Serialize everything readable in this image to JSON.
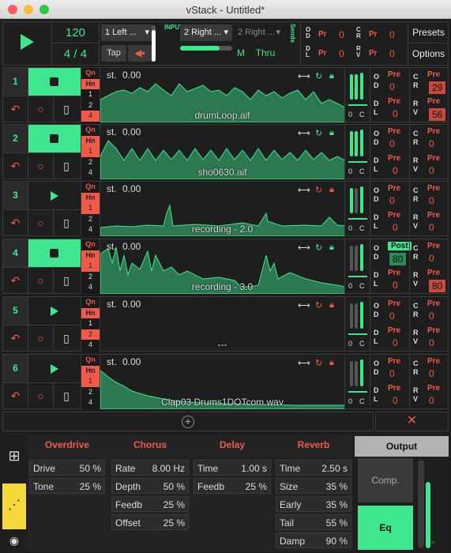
{
  "window": {
    "title": "vStack - Untitled*"
  },
  "colors": {
    "accent": "#3ee68f",
    "red": "#f05a4a",
    "yellow": "#f5d839"
  },
  "transport": {
    "bpm": "120",
    "signature": "4 / 4",
    "tap": "Tap"
  },
  "input": {
    "label": "INPUT",
    "source_left": "1 Left ...",
    "source_right": "2 Right ...",
    "source_right2": "2 Right ...",
    "m": "M",
    "thru": "Thru"
  },
  "sends": {
    "label": "Sends",
    "od_pr": "Pr",
    "od_val": "0",
    "dl_pr": "Pr",
    "dl_val": "0",
    "cr_pr": "Pr",
    "cr_val": "0",
    "rv_pr": "Pr",
    "rv_val": "0",
    "od": "O D",
    "dl": "D L",
    "cr": "C R",
    "rv": "R V"
  },
  "menu": {
    "presets": "Presets",
    "options": "Options"
  },
  "tracks": [
    {
      "num": "1",
      "playing": true,
      "st": "st.",
      "st_val": "0.00",
      "file": "drumLoop.aif",
      "qh": [
        "Qn",
        "Hn",
        "1",
        "2",
        "4"
      ],
      "sel": 3,
      "od": "Pre",
      "od_val": "0",
      "dl": "Pre",
      "dl_val": "0",
      "cr": "Pre",
      "cr_val": "29",
      "rv": "Pre",
      "rv_val": "56",
      "lock": "green"
    },
    {
      "num": "2",
      "playing": true,
      "st": "st.",
      "st_val": "0.00",
      "file": "sho0630.aif",
      "qh": [
        "Qn",
        "Hn",
        "1",
        "2",
        "4"
      ],
      "sel": 1,
      "od": "Pre",
      "od_val": "0",
      "dl": "Pre",
      "dl_val": "0",
      "cr": "Pre",
      "cr_val": "0",
      "rv": "Pre",
      "rv_val": "0",
      "lock": "green"
    },
    {
      "num": "3",
      "playing": false,
      "st": "st.",
      "st_val": "0.00",
      "file": "recording - 2.0",
      "qh": [
        "Qn",
        "Hn",
        "1",
        "2",
        "4"
      ],
      "sel": 1,
      "od": "Pre",
      "od_val": "0",
      "dl": "Pre",
      "dl_val": "0",
      "cr": "Pre",
      "cr_val": "0",
      "rv": "Pre",
      "rv_val": "0",
      "lock": "red"
    },
    {
      "num": "4",
      "playing": true,
      "st": "st.",
      "st_val": "0.00",
      "file": "recording - 3.0",
      "qh": [
        "Qn",
        "Hn",
        "1",
        "2",
        "4"
      ],
      "sel": 1,
      "od": "Post",
      "od_val": "80",
      "dl": "Pre",
      "dl_val": "0",
      "cr": "Pre",
      "cr_val": "0",
      "rv": "Pre",
      "rv_val": "80",
      "lock": "green"
    },
    {
      "num": "5",
      "playing": false,
      "st": "st.",
      "st_val": "0.00",
      "file": "---",
      "qh": [
        "Qn",
        "Hn",
        "1",
        "2",
        "4"
      ],
      "sel": 2,
      "od": "Pre",
      "od_val": "0",
      "dl": "Pre",
      "dl_val": "0",
      "cr": "Pre",
      "cr_val": "0",
      "rv": "Pre",
      "rv_val": "0",
      "lock": "red"
    },
    {
      "num": "6",
      "playing": false,
      "st": "st.",
      "st_val": "0.00",
      "file": "Clap03 Drums1DOTcom.wav",
      "qh": [
        "Qn",
        "Hn",
        "1",
        "2",
        "4"
      ],
      "sel": 1,
      "od": "Pre",
      "od_val": "0",
      "dl": "Pre",
      "dl_val": "0",
      "cr": "Pre",
      "cr_val": "0",
      "rv": "Pre",
      "rv_val": "0",
      "lock": "red"
    }
  ],
  "meter_labels": {
    "o": "0",
    "c": "C"
  },
  "fx": {
    "overdrive": {
      "title": "Overdrive",
      "rows": [
        [
          "Drive",
          "50 %"
        ],
        [
          "Tone",
          "25 %"
        ]
      ]
    },
    "chorus": {
      "title": "Chorus",
      "rows": [
        [
          "Rate",
          "8.00 Hz"
        ],
        [
          "Depth",
          "50 %"
        ],
        [
          "Feedb",
          "25 %"
        ],
        [
          "Offset",
          "25 %"
        ]
      ]
    },
    "delay": {
      "title": "Delay",
      "rows": [
        [
          "Time",
          "1.00 s"
        ],
        [
          "Feedb",
          "25 %"
        ]
      ]
    },
    "reverb": {
      "title": "Reverb",
      "rows": [
        [
          "Time",
          "2.50 s"
        ],
        [
          "Size",
          "35 %"
        ],
        [
          "Early",
          "35 %"
        ],
        [
          "Tail",
          "55 %"
        ],
        [
          "Damp",
          "90 %"
        ]
      ]
    },
    "output": {
      "title": "Output",
      "comp": "Comp.",
      "eq": "Eq"
    }
  }
}
